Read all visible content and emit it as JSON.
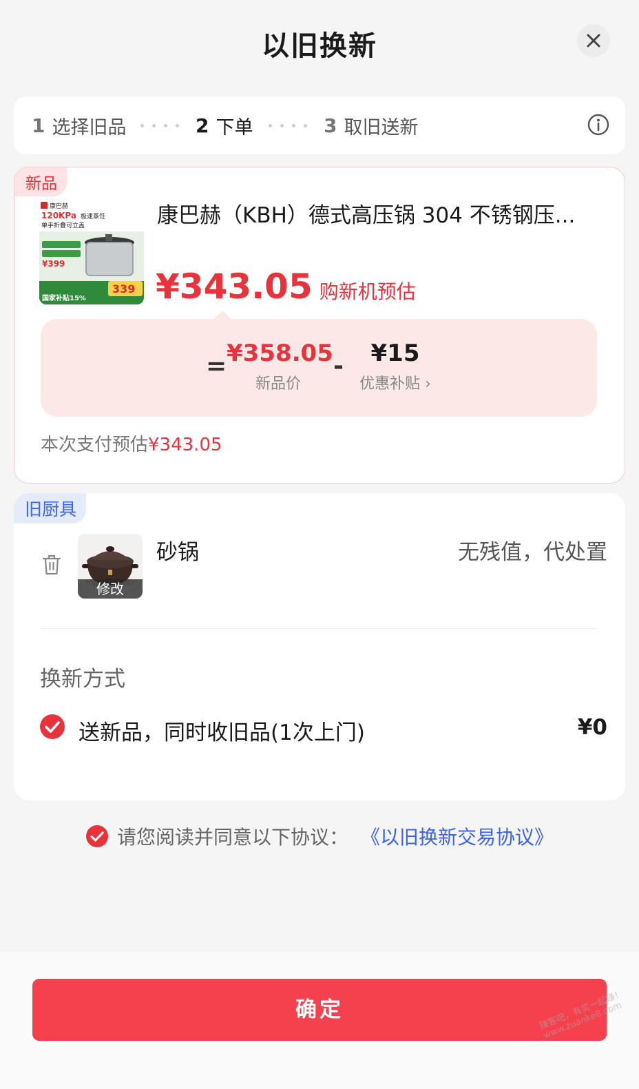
{
  "header": {
    "title": "以旧换新",
    "close_icon": "close-icon"
  },
  "steps": [
    {
      "num": "1",
      "label": "选择旧品",
      "active": false
    },
    {
      "num": "2",
      "label": "下单",
      "active": true
    },
    {
      "num": "3",
      "label": "取旧送新",
      "active": false
    }
  ],
  "new_item": {
    "tag": "新品",
    "name": "康巴赫（KBH）德式高压锅 304 不锈钢压...",
    "estimate_price": "¥343.05",
    "estimate_label": "购新机预估",
    "formula": {
      "equals": "=",
      "new_price": "¥358.05",
      "new_price_label": "新品价",
      "minus": "-",
      "subsidy": "¥15",
      "subsidy_label": "优惠补贴 ›"
    },
    "pay_label": "本次支付预估",
    "pay_amount": "¥343.05",
    "thumb": {
      "brand": "康巴赫",
      "kpa": "120KPa",
      "line1": "极速蒸饪",
      "line2": "单手折叠可立盖",
      "price": "¥399",
      "promo": "339",
      "subsidy_text": "国家补贴15%"
    }
  },
  "old_item": {
    "tag": "旧厨具",
    "name": "砂锅",
    "value": "无残值，代处置",
    "modify_label": "修改",
    "method_title": "换新方式",
    "method_option": "送新品，同时收旧品(1次上门)",
    "method_price": "¥0"
  },
  "agreement": {
    "text": "请您阅读并同意以下协议：",
    "link": "《以旧换新交易协议》"
  },
  "confirm_label": "确定",
  "watermark": "赚客吧，有奖一起赚！ www.zuanke8.com",
  "colors": {
    "accent": "#f5414e",
    "price_red": "#e8333c",
    "link_blue": "#3c64e8"
  }
}
